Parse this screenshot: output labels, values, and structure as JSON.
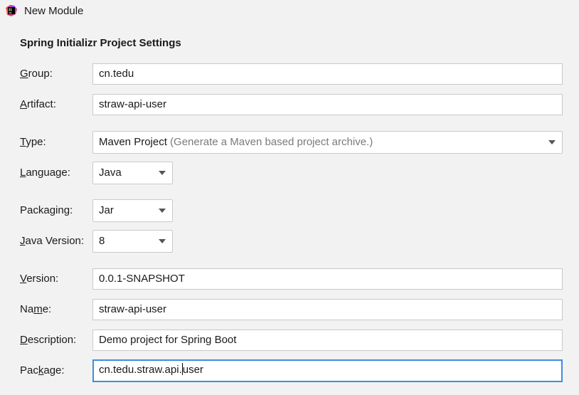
{
  "window": {
    "title": "New Module",
    "icon": "intellij-idea-icon"
  },
  "section_title": "Spring Initializr Project Settings",
  "labels": {
    "group": {
      "pre": "",
      "mn": "G",
      "post": "roup:"
    },
    "artifact": {
      "pre": "",
      "mn": "A",
      "post": "rtifact:"
    },
    "type": {
      "pre": "",
      "mn": "T",
      "post": "ype:"
    },
    "language": {
      "pre": "",
      "mn": "L",
      "post": "anguage:"
    },
    "packaging": {
      "pre": "Packa",
      "mn": "g",
      "post": "ing:"
    },
    "java_version": {
      "pre": "",
      "mn": "J",
      "post": "ava Version:"
    },
    "version": {
      "pre": "",
      "mn": "V",
      "post": "ersion:"
    },
    "name": {
      "pre": "Na",
      "mn": "m",
      "post": "e:"
    },
    "description": {
      "pre": "",
      "mn": "D",
      "post": "escription:"
    },
    "package": {
      "pre": "Pac",
      "mn": "k",
      "post": "age:"
    }
  },
  "fields": {
    "group": "cn.tedu",
    "artifact": "straw-api-user",
    "version": "0.0.1-SNAPSHOT",
    "name": "straw-api-user",
    "description": "Demo project for Spring Boot",
    "package_before_caret": "cn.tedu.straw.api.",
    "package_after_caret": "user"
  },
  "combos": {
    "type": {
      "value": "Maven Project",
      "description": "(Generate a Maven based project archive.)"
    },
    "language": {
      "value": "Java"
    },
    "packaging": {
      "value": "Jar"
    },
    "java_version": {
      "value": "8"
    }
  },
  "colors": {
    "focus_border": "#3d8ee0",
    "background": "#f2f2f2"
  }
}
